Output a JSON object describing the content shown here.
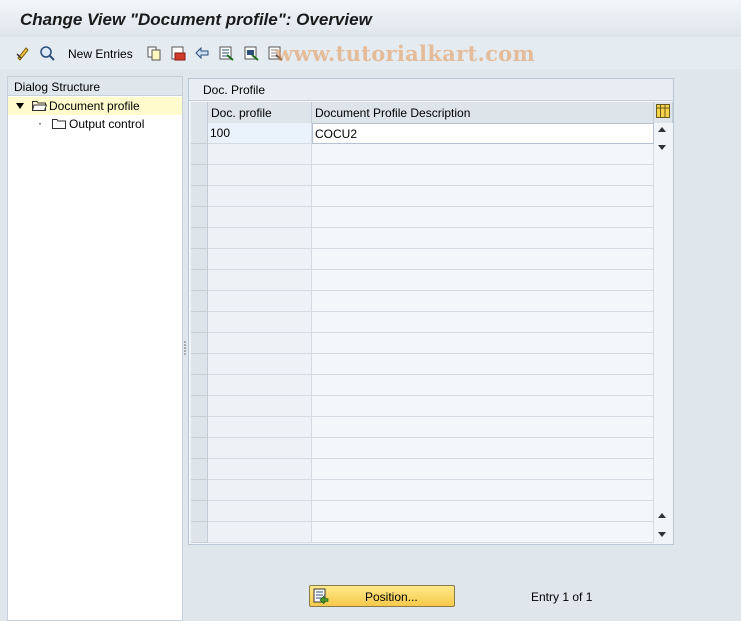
{
  "title": "Change View \"Document profile\": Overview",
  "watermark": "www.tutorialkart.com",
  "toolbar": {
    "new_entries_label": "New Entries",
    "icons": [
      "display-change-icon",
      "details-icon",
      "copy-icon",
      "delete-icon",
      "undo-icon",
      "select-all-icon",
      "select-block-icon",
      "deselect-all-icon"
    ]
  },
  "dialog_structure": {
    "header": "Dialog Structure",
    "items": [
      {
        "label": "Document profile",
        "selected": true,
        "expanded": true
      },
      {
        "label": "Output control",
        "selected": false
      }
    ]
  },
  "table": {
    "title": "Doc. Profile",
    "columns": [
      "Doc. profile",
      "Document Profile Description"
    ],
    "rows": [
      {
        "profile": "100",
        "description": "COCU2"
      }
    ]
  },
  "footer": {
    "position_label": "Position...",
    "entry_text": "Entry 1 of 1"
  },
  "colors": {
    "title_bg": "#dde5ec",
    "selected_tree_item": "#fffbcc",
    "button_yellow": "#f6c94a"
  }
}
